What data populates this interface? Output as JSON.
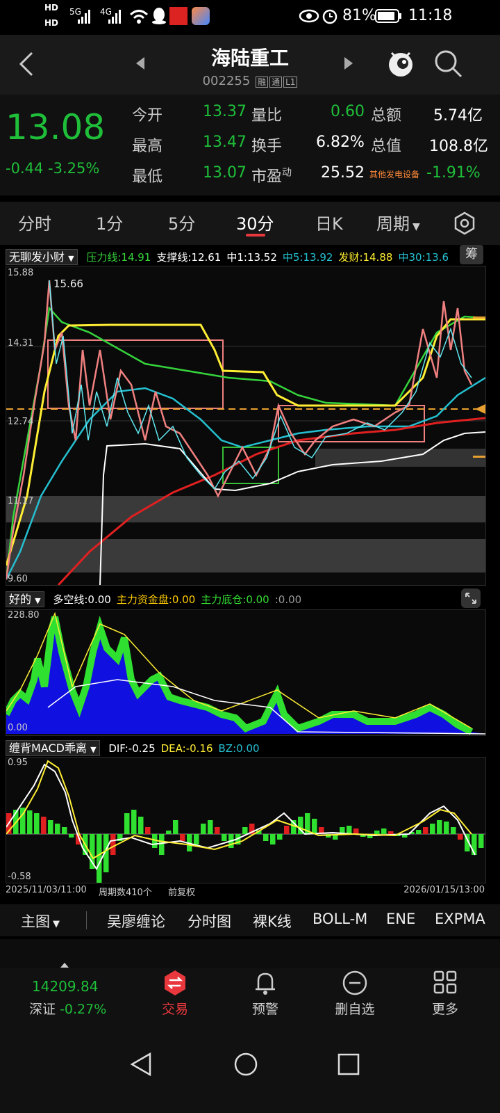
{
  "status_bar": {
    "time": "11:18",
    "battery": "81%",
    "hd1": "HD",
    "hd2": "HD",
    "net1": "5G",
    "net2": "4G"
  },
  "header": {
    "title": "海陆重工",
    "code": "002255",
    "tags": [
      "融",
      "通",
      "L1"
    ],
    "icons": [
      "back-arrow-icon",
      "prev-stock-icon",
      "next-stock-icon",
      "mascot-icon",
      "search-icon"
    ]
  },
  "quote": {
    "price": "13.08",
    "change": "-0.44",
    "change_pct": "-3.25%",
    "rows": [
      [
        {
          "l": "今开",
          "v": "13.37",
          "c": "green"
        },
        {
          "l": "量比",
          "v": "0.60",
          "c": "green"
        },
        {
          "l": "总额",
          "v": "5.74亿",
          "c": "white"
        }
      ],
      [
        {
          "l": "最高",
          "v": "13.47",
          "c": "green"
        },
        {
          "l": "换手",
          "v": "6.82%",
          "c": "white"
        },
        {
          "l": "总值",
          "v": "108.8亿",
          "c": "white"
        }
      ],
      [
        {
          "l": "最低",
          "v": "13.07",
          "c": "green"
        },
        {
          "l": "市盈",
          "v": "25.52",
          "c": "white"
        },
        {
          "l": "其他发电设备",
          "v": "-1.91%",
          "c": "green"
        }
      ]
    ],
    "pe_sup": "动"
  },
  "tabs": [
    "分时",
    "1分",
    "5分",
    "30分",
    "日K",
    "周期"
  ],
  "main_indicator": {
    "name": "无聊发小财",
    "items": [
      {
        "text": "压力线:14.91",
        "color": "#35d43c"
      },
      {
        "text": "支撑线:12.61",
        "color": "#ffffff"
      },
      {
        "text": "中1:13.52",
        "color": "#ffffff"
      },
      {
        "text": "中5:13.92",
        "color": "#25c0d0"
      },
      {
        "text": "发财:14.88",
        "color": "#ffee33"
      },
      {
        "text": "中30:13.6",
        "color": "#25c0d0"
      }
    ],
    "chip_button": "筹",
    "y_labels": [
      "15.88",
      "14.31",
      "12.74",
      "11.17",
      "9.60"
    ],
    "peak_label": "15.66"
  },
  "vol_indicator": {
    "name": "好的",
    "items": [
      {
        "text": "多空线:0.00",
        "color": "#ffffff"
      },
      {
        "text": "主力资金盘:0.00",
        "color": "#ffcc00"
      },
      {
        "text": "主力底仓:0.00",
        "color": "#33dd33"
      },
      {
        "text": ":0.00",
        "color": "#999999"
      }
    ],
    "y_labels": [
      "228.80",
      "0.00"
    ]
  },
  "macd_indicator": {
    "name": "缠背MACD乖离",
    "items": [
      {
        "text": "DIF:-0.25",
        "color": "#ffffff"
      },
      {
        "text": "DEA:-0.16",
        "color": "#ffee33"
      },
      {
        "text": "BZ:0.00",
        "color": "#25c0d0"
      }
    ],
    "y_labels": [
      "0.95",
      "-0.58"
    ]
  },
  "footer_info": {
    "start": "2025/11/03/11:00",
    "period_count": "周期数410个",
    "adjust": "前复权",
    "end": "2026/01/15/13:00"
  },
  "toolbar": {
    "main": "主图",
    "items": [
      "吴廖缠论",
      "分时图",
      "裸K线",
      "BOLL-M",
      "ENE",
      "EXPMA"
    ]
  },
  "bottom_nav": {
    "index_value": "14209.84",
    "index_name": "深证",
    "index_change": "-0.27%",
    "items": [
      {
        "label": "交易",
        "icon": "trade-icon"
      },
      {
        "label": "预警",
        "icon": "bell-icon"
      },
      {
        "label": "删自选",
        "icon": "minus-circle-icon"
      },
      {
        "label": "更多",
        "icon": "grid-icon"
      }
    ]
  },
  "colors": {
    "green": "#1fbf3a",
    "red": "#e02020",
    "accent": "#e8383d",
    "yellow": "#ffee33",
    "cyan": "#25c0d0"
  }
}
